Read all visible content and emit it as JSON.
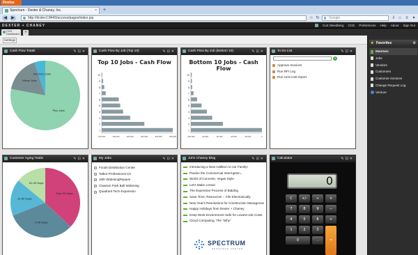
{
  "browser": {
    "app_button": "Firefox",
    "tab_title": "Spectrum - Dexter & Chaney, Inc.",
    "url": "http://dcdev1:8443/access/pages/index.jsp",
    "search_placeholder": "Google"
  },
  "app": {
    "brand": "DEXTER + CHANEY",
    "user": "Curt Weedberg",
    "company": "CCD",
    "menu": [
      "Preferences",
      "Help",
      "About",
      "Sign Out"
    ],
    "dashboard_tab": "CCD Dashboard",
    "settings_label": "Settings"
  },
  "panels": {
    "cash_flow_totals": {
      "title": "Cash Flow Totals",
      "chart_data": {
        "type": "pie",
        "labels": [
          "Plus Jobs",
          "Minus Jobs",
          "Net Zero Jobs"
        ],
        "values": [
          78,
          17,
          5
        ],
        "colors": [
          "#8fd3b0",
          "#7a8e92",
          "#4ab7d8"
        ]
      }
    },
    "top10": {
      "title": "Cash Flow By Job (Top 10)",
      "chart_title": "Top 10 Jobs - Cash Flow",
      "chart_data": {
        "type": "bar",
        "orientation": "horizontal",
        "categories": [
          "10",
          "9",
          "8",
          "7",
          "6",
          "5",
          "4",
          "3",
          "2",
          "1"
        ],
        "values": [
          2000,
          5000,
          9000,
          14000,
          60000,
          65000,
          75000,
          100000,
          150000,
          250000
        ],
        "xticks": [
          "100,000",
          "150,000",
          "200,000",
          "250,000",
          "300,000",
          "350,000"
        ],
        "color": "#8a9ba2"
      }
    },
    "bottom10": {
      "title": "Cash Flow By Job (Bottom 10)",
      "chart_title": "Bottom 10 Jobs - Cash Flow",
      "chart_data": {
        "type": "bar",
        "orientation": "horizontal",
        "categories": [
          "10",
          "9",
          "8",
          "7",
          "6",
          "5",
          "4",
          "3",
          "2",
          "1"
        ],
        "values": [
          -500,
          -600,
          -700,
          -1500,
          -3500,
          -6000,
          -9000,
          -12000,
          -18000,
          -40000
        ],
        "xticks": [
          "-100,000",
          "-80,000",
          "-60,000",
          "-40,000",
          "-20,000",
          "0"
        ],
        "color": "#8a9ba2"
      }
    },
    "todo": {
      "title": "To Do List",
      "items": [
        "Approve Invoices",
        "Run RFI Log",
        "Run Unit Cost report"
      ]
    },
    "aging": {
      "title": "Customer Aging Totals",
      "chart_data": {
        "type": "pie",
        "labels": [
          "Over 90 Days",
          "0-30 Days",
          "31-60 Days",
          "61-90 Days"
        ],
        "values": [
          37,
          32,
          17,
          14
        ],
        "colors": [
          "#d1417a",
          "#5c8a9a",
          "#56b8d6",
          "#b8dfa8"
        ]
      }
    },
    "my_jobs": {
      "title": "My Jobs",
      "items": [
        "Foods Distribution Center",
        "Talbot Professional Ctr",
        "16th WideningRepave",
        "Clawson Park Ball Widening",
        "Quadrant Tech Expansion"
      ]
    },
    "blog": {
      "title": "John Chaney Blog",
      "items": [
        "Introducing a New Addition to our Family!",
        "Pardon the Commercial Interruption...",
        "World of Concrete, Vegas Style",
        "Let's Make a Deal",
        "The Expensive Process of Bidding",
        "Save Time, Resources -- File Electronically",
        "New Year's Resolutions for Construction Management",
        "Happy Holidays from Dexter + Chaney",
        "Keep Work Environment Safe for Lowest Job Costs",
        "Cloud Computing: The \"Why\""
      ],
      "logo_word": "SPECTRUM",
      "logo_sub": "RESOURCE CENTER"
    },
    "calculator": {
      "title": "Calculator",
      "display": "0",
      "keys": [
        "C",
        "+/-",
        "÷",
        "×",
        "7",
        "8",
        "9",
        "−",
        "4",
        "5",
        "6",
        "+",
        "1",
        "2",
        "3",
        "=",
        "0",
        ".",
        ""
      ]
    }
  },
  "favorites": {
    "title": "Favorites",
    "items": [
      "Maintain",
      "Jobs",
      "Vendors",
      "Customers",
      "Customer Invoices",
      "Change Request Log",
      "Venture"
    ]
  }
}
